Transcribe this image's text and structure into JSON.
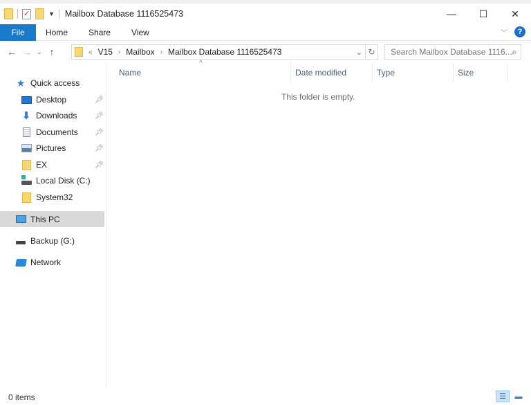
{
  "window": {
    "title": "Mailbox Database 1116525473",
    "controls": {
      "minimize": "—",
      "maximize": "☐",
      "close": "✕"
    }
  },
  "ribbon": {
    "tabs": [
      {
        "label": "File",
        "active": true
      },
      {
        "label": "Home"
      },
      {
        "label": "Share"
      },
      {
        "label": "View"
      }
    ],
    "help_label": "?",
    "expand_icon": "chevron-down-icon"
  },
  "navigation": {
    "back": "←",
    "forward": "→",
    "recent": "⌄",
    "up": "↑",
    "overflow": "«",
    "breadcrumbs": [
      "V15",
      "Mailbox",
      "Mailbox Database 1116525473"
    ],
    "crumb_separator": "›",
    "refresh": "↻",
    "search_placeholder": "Search Mailbox Database 1116...",
    "search_icon": "⌕"
  },
  "sidebar": {
    "quick_access": {
      "label": "Quick access",
      "items": [
        {
          "label": "Desktop",
          "icon": "desktop-icon",
          "pinned": true
        },
        {
          "label": "Downloads",
          "icon": "downloads-icon",
          "pinned": true
        },
        {
          "label": "Documents",
          "icon": "documents-icon",
          "pinned": true
        },
        {
          "label": "Pictures",
          "icon": "pictures-icon",
          "pinned": true
        },
        {
          "label": "EX",
          "icon": "folder-icon",
          "pinned": true
        },
        {
          "label": "Local Disk (C:)",
          "icon": "disk-icon",
          "pinned": false
        },
        {
          "label": "System32",
          "icon": "folder-icon",
          "pinned": false
        }
      ]
    },
    "this_pc": {
      "label": "This PC",
      "selected": true
    },
    "backup": {
      "label": "Backup (G:)"
    },
    "network": {
      "label": "Network"
    }
  },
  "columns": [
    "Name",
    "Date modified",
    "Type",
    "Size"
  ],
  "sort_indicator": "^",
  "empty_message": "This folder is empty.",
  "status": {
    "item_count": "0 items"
  }
}
